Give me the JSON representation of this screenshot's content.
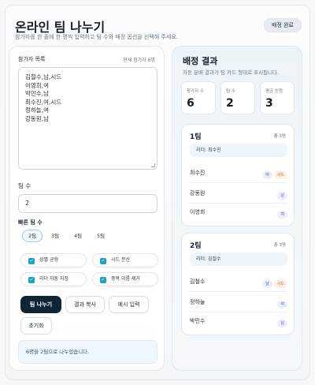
{
  "header": {
    "title": "온라인 팀 나누기",
    "subtitle": "참가자를 한 줄에 한 명씩 입력하고 팀 수와 배정 옵션을 선택해 주세요.",
    "done_button": "배정 완료"
  },
  "participants": {
    "label": "참가자 목록",
    "count_label": "현재 참가자 6명",
    "lines": [
      "김철수,남,시드",
      "이영희,여",
      "박민수,남",
      "최수진,여,시드",
      "정하늘,여",
      "강동원,남"
    ]
  },
  "team_count": {
    "label": "팀 수",
    "value": "2"
  },
  "quick": {
    "label": "빠른 팀 수",
    "chips": [
      "2팀",
      "3팀",
      "4팀",
      "5팀"
    ],
    "active_index": 0
  },
  "options": [
    {
      "label": "성별 균형",
      "checked": true
    },
    {
      "label": "시드 분산",
      "checked": true
    },
    {
      "label": "리더 자동 지정",
      "checked": true
    },
    {
      "label": "중복 이름 제거",
      "checked": true
    }
  ],
  "actions": {
    "split": "팀 나누기",
    "copy": "결과 복사",
    "example": "예시 입력",
    "reset": "초기화"
  },
  "notice": "6명을 2팀으로 나누었습니다.",
  "result": {
    "title": "배정 결과",
    "subtitle": "자동 분배 결과가 팀 카드 형태로 표시됩니다.",
    "stats": [
      {
        "label": "참가자 수",
        "value": "6"
      },
      {
        "label": "팀 수",
        "value": "2"
      },
      {
        "label": "평균 인원",
        "value": "3"
      }
    ],
    "teams": [
      {
        "name": "1팀",
        "count": "총 3명",
        "leader": "리더: 최수진",
        "members": [
          {
            "name": "최수진",
            "tags": [
              "여",
              "시드"
            ]
          },
          {
            "name": "강동원",
            "tags": [
              "남"
            ]
          },
          {
            "name": "이영희",
            "tags": [
              "여"
            ]
          }
        ]
      },
      {
        "name": "2팀",
        "count": "총 3명",
        "leader": "리더: 김철수",
        "members": [
          {
            "name": "김철수",
            "tags": [
              "남",
              "시드"
            ]
          },
          {
            "name": "정하늘",
            "tags": [
              "여"
            ]
          },
          {
            "name": "박민수",
            "tags": [
              "남"
            ]
          }
        ]
      }
    ]
  }
}
